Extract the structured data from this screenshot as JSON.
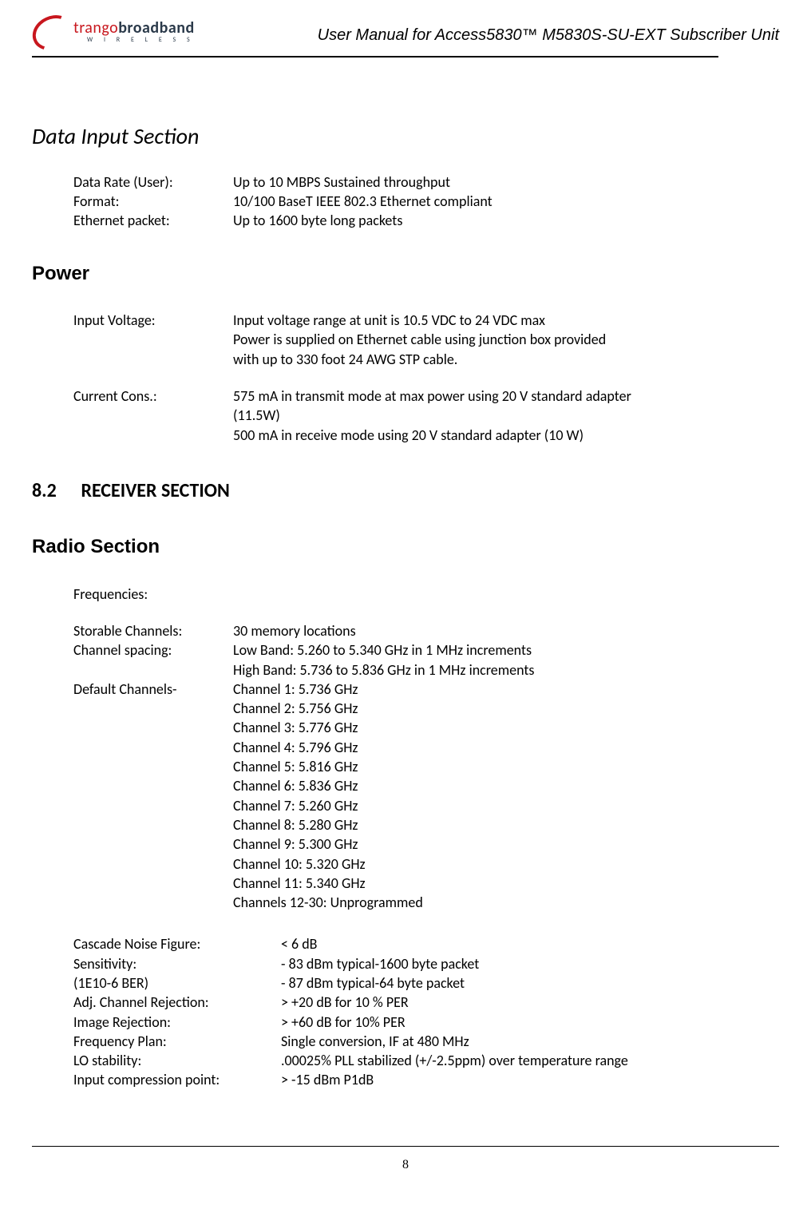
{
  "logo": {
    "part1": "trango",
    "part2": "broadband",
    "sub": "W I R E L E S S"
  },
  "header_title": "User Manual for Access5830™ M5830S-SU-EXT Subscriber Unit",
  "sections": {
    "data_input": {
      "title": "Data Input Section",
      "rows": [
        {
          "label": "Data Rate (User):",
          "value": "Up to 10 MBPS Sustained throughput"
        },
        {
          "label": "Format:",
          "value": "10/100 BaseT IEEE 802.3 Ethernet compliant"
        },
        {
          "label": "Ethernet packet:",
          "value": "Up to 1600 byte long packets"
        }
      ]
    },
    "power": {
      "title": "Power",
      "input_voltage": {
        "label": "Input Voltage:",
        "lines": [
          "Input voltage range at unit is 10.5 VDC to 24 VDC max",
          "Power is supplied on Ethernet cable using junction box provided",
          "with up to 330 foot 24 AWG STP cable."
        ]
      },
      "current_cons": {
        "label": "Current Cons.:",
        "lines": [
          "575 mA in transmit mode at max power using 20 V standard adapter",
          "(11.5W)",
          "500 mA in receive mode using 20 V standard adapter (10 W)"
        ]
      }
    },
    "receiver_heading": {
      "num": "8.2",
      "title": "RECEIVER SECTION"
    },
    "radio": {
      "title": "Radio Section",
      "frequencies_label": "Frequencies:",
      "storable": {
        "label": "Storable Channels:",
        "value": "30 memory locations"
      },
      "spacing": {
        "label": "Channel spacing:",
        "lines": [
          "Low Band: 5.260 to 5.340 GHz in 1 MHz increments",
          "High Band: 5.736 to 5.836 GHz in 1 MHz increments"
        ]
      },
      "default_channels": {
        "label": "Default Channels-",
        "lines": [
          "Channel 1: 5.736 GHz",
          "Channel 2: 5.756 GHz",
          "Channel 3: 5.776 GHz",
          "Channel 4: 5.796 GHz",
          "Channel 5: 5.816 GHz",
          "Channel 6: 5.836 GHz",
          "Channel 7: 5.260 GHz",
          "Channel 8: 5.280 GHz",
          "Channel 9: 5.300 GHz",
          "Channel 10: 5.320 GHz",
          "Channel 11: 5.340 GHz",
          "Channels 12-30: Unprogrammed"
        ]
      },
      "specs": [
        {
          "label": "Cascade Noise Figure:",
          "value": "< 6 dB"
        },
        {
          "label": "Sensitivity:",
          "value": "- 83 dBm typical-1600 byte packet"
        },
        {
          "label": "(1E10-6 BER)",
          "value": "- 87 dBm typical-64 byte packet"
        },
        {
          "label": "Adj. Channel Rejection:",
          "value": "> +20 dB for 10 % PER"
        },
        {
          "label": "Image Rejection:",
          "value": "> +60 dB for 10% PER"
        },
        {
          "label": "Frequency Plan:",
          "value": "Single conversion, IF at 480 MHz"
        },
        {
          "label": "LO stability:",
          "value": ".00025% PLL stabilized (+/-2.5ppm) over temperature range"
        },
        {
          "label": "Input compression point:",
          "value": "> -15 dBm P1dB"
        }
      ]
    }
  },
  "page_number": "8"
}
